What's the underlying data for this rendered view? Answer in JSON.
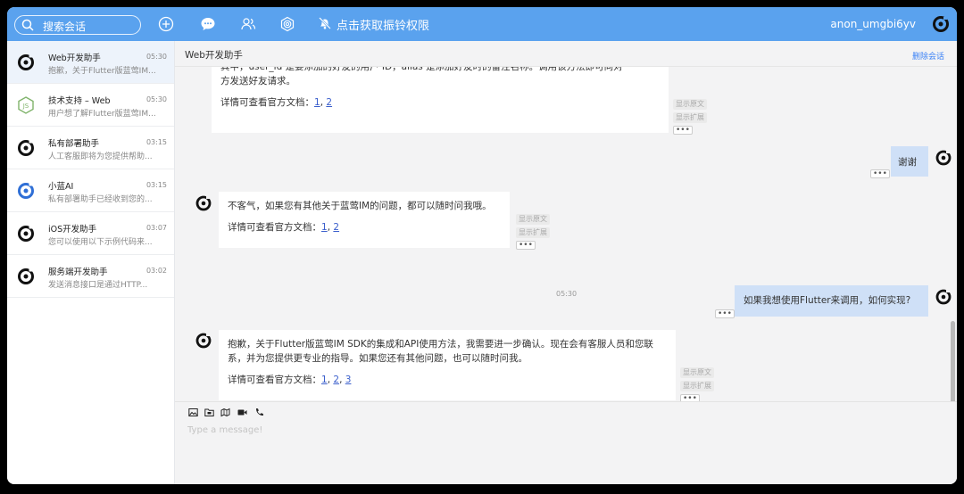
{
  "topbar": {
    "search_placeholder": "搜索会话",
    "notice": "点击获取振铃权限",
    "username": "anon_umgbi6yv",
    "icons": [
      "search-icon",
      "add-icon",
      "chat-icon",
      "contacts-icon",
      "settings-icon",
      "bell-off-icon"
    ]
  },
  "sidebar": {
    "conversations": [
      {
        "name": "Web开发助手",
        "time": "05:30",
        "preview": "抱歉，关于Flutter版蓝莺IM...",
        "avatar": "bot-logo"
      },
      {
        "name": "技术支持 – Web",
        "time": "05:30",
        "preview": "用户想了解Flutter版蓝莺IM...",
        "avatar": "node-js-logo"
      },
      {
        "name": "私有部署助手",
        "time": "03:15",
        "preview": "人工客服即将为您提供帮助...",
        "avatar": "bot-logo"
      },
      {
        "name": "小蓝AI",
        "time": "03:15",
        "preview": "私有部署助手已经收到您的...",
        "avatar": "blue-bot-logo"
      },
      {
        "name": "iOS开发助手",
        "time": "03:07",
        "preview": "您可以使用以下示例代码来...",
        "avatar": "bot-logo"
      },
      {
        "name": "服务端开发助手",
        "time": "03:02",
        "preview": "发送消息接口是通过HTTP...",
        "avatar": "bot-logo"
      }
    ]
  },
  "chat": {
    "title": "Web开发助手",
    "delete_label": "删除会话",
    "show_original": "显示原文",
    "show_extended": "显示扩展",
    "more": "•••",
    "timestamp": "05:30",
    "doc_prefix": "详情可查看官方文档：",
    "msg1": {
      "line1": "其中，user_id 是要添加的好友的用户 ID，alias 是添加好友时的备注名称。调用该方法即可向对",
      "line2": "方发送好友请求。",
      "links": [
        "1",
        "2"
      ]
    },
    "msg2": {
      "text": "谢谢"
    },
    "msg3": {
      "text": "不客气，如果您有其他关于蓝莺IM的问题，都可以随时问我哦。",
      "links": [
        "1",
        "2"
      ]
    },
    "msg4": {
      "text": "如果我想使用Flutter来调用，如何实现?"
    },
    "msg5": {
      "line1": "抱歉，关于Flutter版蓝莺IM SDK的集成和API使用方法，我需要进一步确认。现在会有客服人员和您联",
      "line2": "系，并为您提供更专业的指导。如果您还有其他问题，也可以随时问我。",
      "links": [
        "1",
        "2",
        "3"
      ]
    },
    "input_placeholder": "Type a message!",
    "tools": [
      "image-icon",
      "folder-icon",
      "location-icon",
      "video-icon",
      "phone-icon"
    ]
  }
}
